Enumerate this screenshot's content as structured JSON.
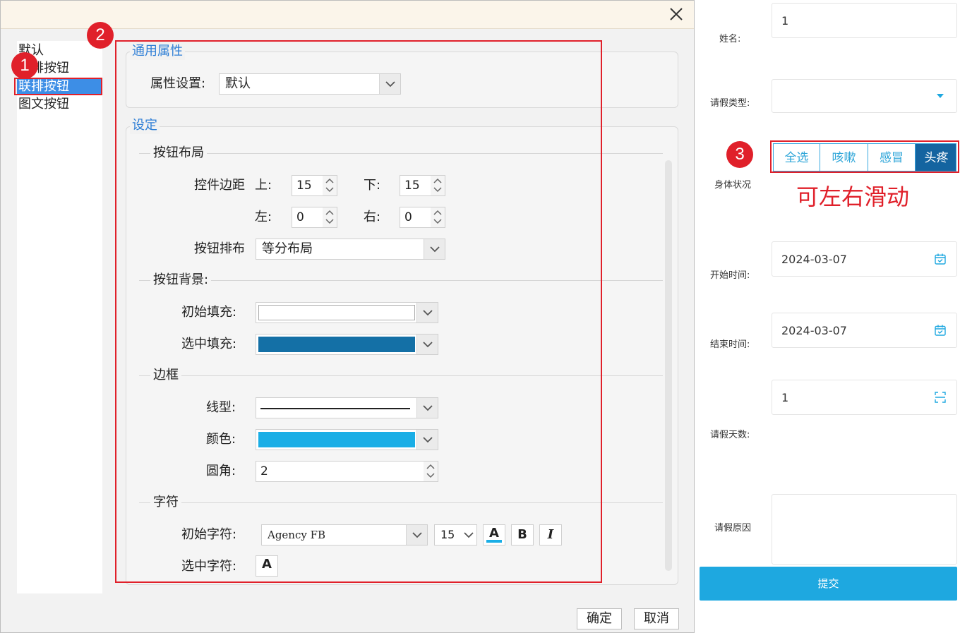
{
  "dialog": {
    "type_list": [
      "默认",
      "联排按钮",
      "联排按钮",
      "图文按钮"
    ],
    "badges": [
      "1",
      "2",
      "3"
    ],
    "general": {
      "title": "通用属性",
      "prop_label": "属性设置:",
      "prop_value": "默认"
    },
    "settings": {
      "title": "设定",
      "layout_section": "按钮布局",
      "margin_label": "控件边距",
      "top_label": "上:",
      "top_value": "15",
      "bottom_label": "下:",
      "bottom_value": "15",
      "left_label": "左:",
      "left_value": "0",
      "right_label": "右:",
      "right_value": "0",
      "arrange_label": "按钮排布",
      "arrange_value": "等分布局",
      "bg_section": "按钮背景:",
      "init_fill_label": "初始填充:",
      "init_fill_color": "#ffffff",
      "sel_fill_label": "选中填充:",
      "sel_fill_color": "#1470a6",
      "border_section": "边框",
      "line_label": "线型:",
      "color_label": "颜色:",
      "border_color": "#1aaee6",
      "radius_label": "圆角:",
      "radius_value": "2",
      "char_section": "字符",
      "init_char_label": "初始字符:",
      "font_name": "Agency FB",
      "font_size": "15",
      "font_color_glyph": "A",
      "bold_glyph": "B",
      "italic_glyph": "I",
      "sel_char_label": "选中字符:",
      "sel_char_glyph": "A"
    },
    "ok": "确定",
    "cancel": "取消"
  },
  "form": {
    "name_label": "姓名:",
    "name_value": "1",
    "leave_type_label": "请假类型:",
    "health_label": "身体状况",
    "segments": [
      "全选",
      "咳嗽",
      "感冒",
      "头疼"
    ],
    "active_segment": "头疼",
    "slide_note": "可左右滑动",
    "start_label": "开始时间:",
    "start_value": "2024-03-07",
    "end_label": "结束时间:",
    "end_value": "2024-03-07",
    "days_label": "请假天数:",
    "days_value": "1",
    "reason_label": "请假原因",
    "submit": "提交",
    "accent_color": "#1ea8e0"
  }
}
